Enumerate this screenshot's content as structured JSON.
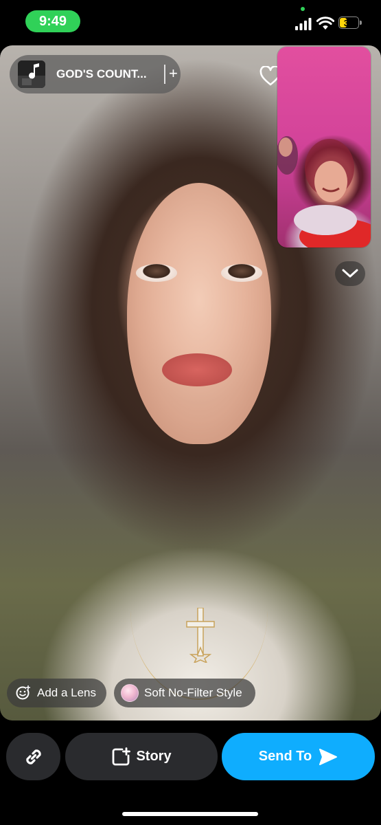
{
  "status_bar": {
    "time": "9:49",
    "battery_level": "37",
    "battery_percent": 37,
    "time_pill_color": "#30d158",
    "icons": [
      "signal-icon",
      "wifi-icon",
      "battery-icon"
    ]
  },
  "camera": {
    "music": {
      "title": "GOD'S COUNT...",
      "add_symbol": "+",
      "icon": "music-note-icon"
    },
    "favorite_icon": "heart-icon",
    "collapse_icon": "chevron-down-icon"
  },
  "pills": {
    "lens_label": "Add a Lens",
    "style_label": "Soft No-Filter Style"
  },
  "actions": {
    "link_icon": "link-icon",
    "story_label": "Story",
    "send_label": "Send To",
    "send_color": "#0fadfe"
  }
}
